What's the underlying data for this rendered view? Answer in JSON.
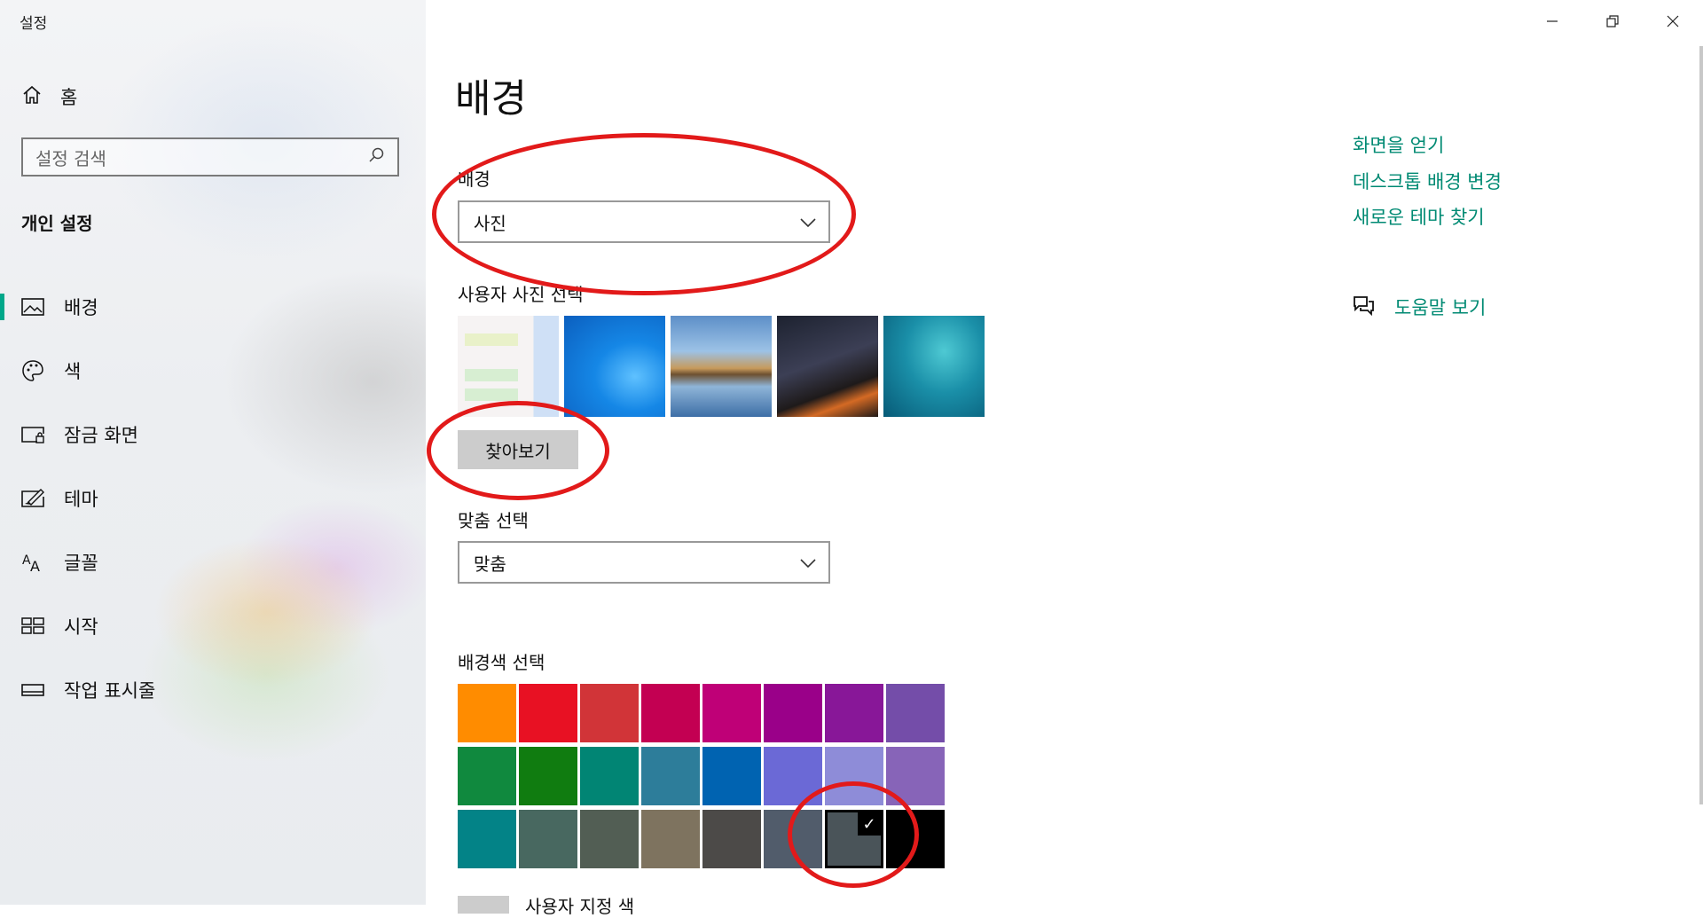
{
  "window": {
    "title": "설정",
    "controls": [
      "minimize",
      "restore",
      "close"
    ]
  },
  "sidebar": {
    "home_label": "홈",
    "search_placeholder": "설정 검색",
    "section_title": "개인 설정",
    "items": [
      {
        "label": "배경",
        "icon": "picture-icon",
        "active": true
      },
      {
        "label": "색",
        "icon": "palette-icon",
        "active": false
      },
      {
        "label": "잠금 화면",
        "icon": "lock-screen-icon",
        "active": false
      },
      {
        "label": "테마",
        "icon": "theme-brush-icon",
        "active": false
      },
      {
        "label": "글꼴",
        "icon": "font-icon",
        "active": false
      },
      {
        "label": "시작",
        "icon": "start-tiles-icon",
        "active": false
      },
      {
        "label": "작업 표시줄",
        "icon": "taskbar-icon",
        "active": false
      }
    ]
  },
  "main": {
    "page_title": "배경",
    "background_label": "배경",
    "background_value": "사진",
    "choose_picture_label": "사용자 사진 선택",
    "thumbnails": [
      "recent-image-1",
      "recent-image-2",
      "recent-image-3",
      "recent-image-4",
      "recent-image-5"
    ],
    "browse_label": "찾아보기",
    "fit_label": "맞춤 선택",
    "fit_value": "맞춤",
    "color_label": "배경색 선택",
    "colors": [
      "#ff8c00",
      "#e81123",
      "#d13438",
      "#c30052",
      "#bf0077",
      "#9a0089",
      "#881798",
      "#744da9",
      "#10893e",
      "#107c10",
      "#018574",
      "#2d7d9a",
      "#0063b1",
      "#6b69d6",
      "#8e8cd8",
      "#8764b8",
      "#038387",
      "#486860",
      "#525e54",
      "#7e735f",
      "#4c4a48",
      "#515c6b",
      "#4a5459",
      "#000000"
    ],
    "selected_color_index": 22,
    "check_glyph": "✓",
    "custom_color_label": "사용자 지정 색"
  },
  "related": {
    "links": [
      "화면을 얻기",
      "데스크톱 배경 변경",
      "새로운 테마 찾기"
    ],
    "help_label": "도움말 보기"
  },
  "annotation_color": "#e21a1a",
  "accent_color": "#008a73"
}
